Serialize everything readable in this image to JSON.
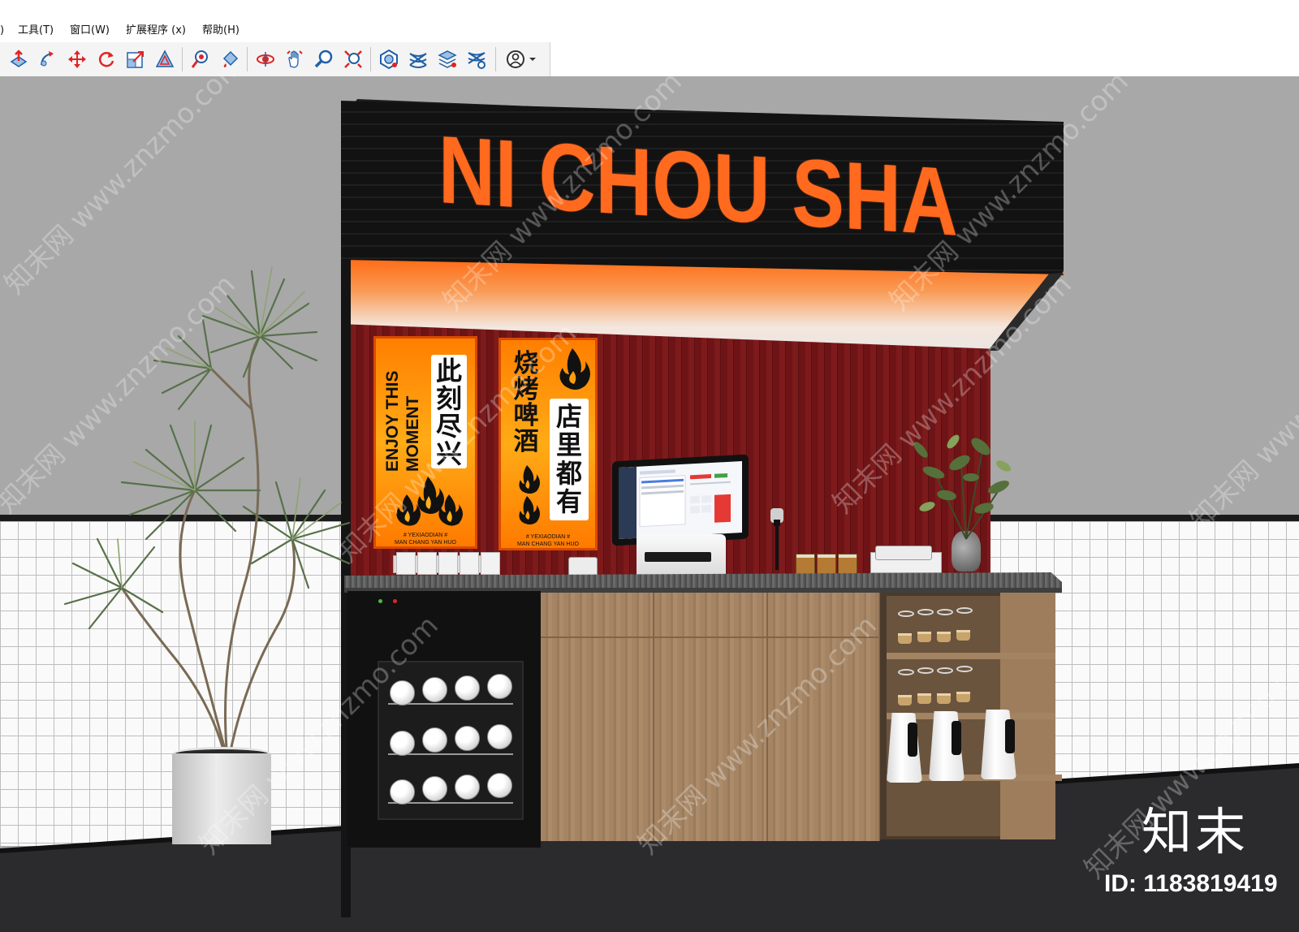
{
  "menubar": {
    "items": [
      {
        "label": ")"
      },
      {
        "label": "工具(T)"
      },
      {
        "label": "窗口(W)"
      },
      {
        "label": "扩展程序 (x)"
      },
      {
        "label": "帮助(H)"
      }
    ]
  },
  "toolbar": {
    "tools": [
      {
        "name": "push-pull-icon"
      },
      {
        "name": "follow-me-icon"
      },
      {
        "name": "move-icon"
      },
      {
        "name": "rotate-icon"
      },
      {
        "name": "scale-icon"
      },
      {
        "name": "offset-icon"
      },
      {
        "name": "tape-measure-icon"
      },
      {
        "name": "paint-bucket-icon"
      },
      {
        "name": "orbit-icon"
      },
      {
        "name": "pan-icon"
      },
      {
        "name": "zoom-icon"
      },
      {
        "name": "zoom-extents-icon"
      },
      {
        "name": "warehouse-icon"
      },
      {
        "name": "extension-warehouse-icon"
      },
      {
        "name": "layout-icon"
      },
      {
        "name": "extension-manager-icon"
      },
      {
        "name": "account-icon"
      }
    ],
    "colors": {
      "accent_red": "#e02424",
      "accent_blue": "#1f5fa8"
    }
  },
  "scene": {
    "sign_text": "NI CHOU SHA",
    "poster_left": {
      "chars": [
        "此",
        "刻",
        "尽",
        "兴"
      ],
      "english": "ENJOY THIS MOMENT",
      "foot_line1": "# YEXIAODIAN #",
      "foot_line2": "MAN CHANG YAN HUO"
    },
    "poster_right": {
      "chars_left": [
        "烧",
        "烤",
        "啤",
        "酒"
      ],
      "chars_right": [
        "店",
        "里",
        "都",
        "有"
      ],
      "foot_line1": "# YEXIAODIAN #",
      "foot_line2": "MAN CHANG YAN HUO"
    },
    "colors": {
      "sign_orange": "#ff6a1f",
      "wall_red": "#7d1a1b",
      "poster_orange": "#ff8c00"
    }
  },
  "watermark": {
    "site": "www.znzmo.com",
    "site_cn": "知末网",
    "brand": "知末",
    "id_text": "ID: 1183819419"
  }
}
